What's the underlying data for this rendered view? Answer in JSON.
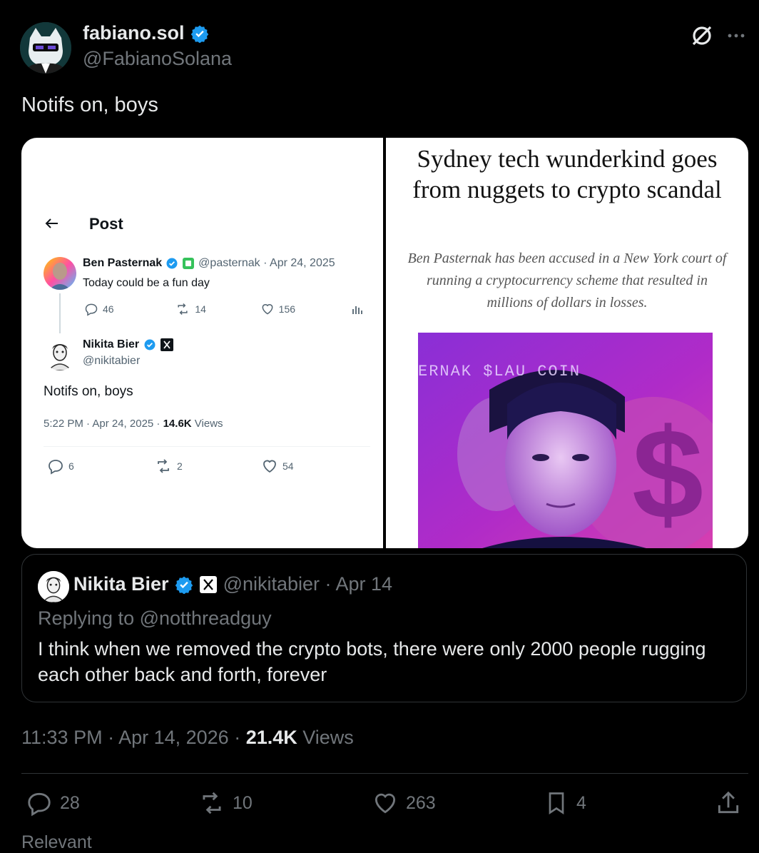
{
  "post": {
    "author_name": "fabiano.sol",
    "author_handle": "@FabianoSolana",
    "text": "Notifs on, boys",
    "timestamp": "11:33 PM · Apr 14, 2026",
    "views_count": "21.4K",
    "views_label": "Views",
    "replies": "28",
    "reposts": "10",
    "likes": "263",
    "bookmarks": "4"
  },
  "media_left": {
    "title": "Post",
    "tweet1": {
      "name": "Ben Pasternak",
      "handle_date": "@pasternak · Apr 24, 2025",
      "text": "Today could be a fun day",
      "replies": "46",
      "reposts": "14",
      "likes": "156"
    },
    "tweet2": {
      "name": "Nikita Bier",
      "handle": "@nikitabier",
      "text": "Notifs on, boys",
      "time": "5:22 PM · Apr 24, 2025 · ",
      "views_count": "14.6K",
      "views_label": "Views",
      "replies": "6",
      "reposts": "2",
      "likes": "54"
    }
  },
  "media_right": {
    "headline": "Sydney tech wunderkind goes from nuggets to crypto scandal",
    "subheadline": "Ben Pasternak has been accused in a New York court of running a cryptocurrency scheme that resulted in millions of dollars in losses.",
    "image_text": "ERNAK $LAU   COIN"
  },
  "quote": {
    "name": "Nikita Bier",
    "handle_date": "@nikitabier · Apr 14",
    "replying": "Replying to @notthreadguy",
    "text": "I think when we removed the crypto bots, there were only 2000 people rugging each other back and forth, forever"
  },
  "footer": {
    "relevant": "Relevant"
  },
  "colors": {
    "verified": "#1d9bf0",
    "background": "#000000",
    "muted": "#71767b",
    "text": "#e7e9ea"
  },
  "icons": [
    "verified-badge-icon",
    "grok-icon",
    "more-icon",
    "back-arrow-icon",
    "reply-icon",
    "repost-icon",
    "like-icon",
    "analytics-icon",
    "bookmark-icon",
    "share-icon",
    "x-logo-icon"
  ]
}
